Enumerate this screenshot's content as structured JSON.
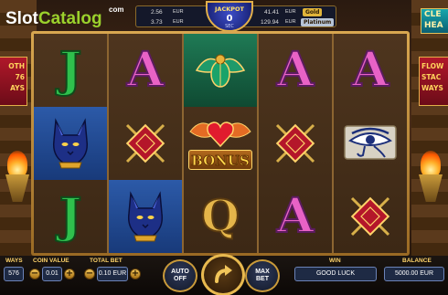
{
  "watermark": {
    "slot": "Slot",
    "catalog": "Catalog",
    "com": "com"
  },
  "jackpot_bar": {
    "title": "JACKPOT",
    "value": "0",
    "unit": "SEC",
    "left_top_value": "2.56",
    "left_top_currency": "EUR",
    "left_bottom_value": "3.73",
    "left_bottom_currency": "EUR",
    "right_top_value": "41.41",
    "right_top_currency": "EUR",
    "right_top_tier": "Gold",
    "right_bottom_value": "129.94",
    "right_bottom_currency": "EUR",
    "right_bottom_tier": "Platinum",
    "colors": {
      "gold": "#e0b43a",
      "platinum": "#b7c4d6"
    }
  },
  "side_banner_left": {
    "line1": "OTH",
    "line2": "76",
    "line3": "AYS"
  },
  "side_banner_right": {
    "line1": "FLOW",
    "line2": "STAC",
    "line3": "WAYS"
  },
  "game_logo_right": {
    "line1": "CLE",
    "line2": "HEA"
  },
  "reels": [
    [
      "J",
      "cat",
      "J"
    ],
    [
      "A",
      "shield",
      "cat"
    ],
    [
      "scarab",
      "BONUS",
      "Q"
    ],
    [
      "A",
      "shield",
      "A"
    ],
    [
      "A",
      "eye",
      "shield"
    ]
  ],
  "bonus_label": "BONUS",
  "controls": {
    "ways_label": "WAYS",
    "ways_value": "576",
    "coin_value_label": "COIN VALUE",
    "coin_value": "0.01",
    "total_bet_label": "TOTAL BET",
    "total_bet": "0.10 EUR",
    "auto_label_1": "AUTO",
    "auto_label_2": "OFF",
    "max_bet_label_1": "MAX",
    "max_bet_label_2": "BET",
    "win_label": "WIN",
    "win_value": "GOOD LUCK",
    "balance_label": "BALANCE",
    "balance_value": "5000.00 EUR",
    "minus": "−",
    "plus": "+"
  },
  "icons": {
    "spin": "spin-arrow-icon",
    "scarab": "scarab-icon",
    "cat": "bastet-cat-icon",
    "shield": "crossed-shield-icon",
    "eye": "eye-of-horus-icon",
    "heart": "winged-heart-icon"
  }
}
